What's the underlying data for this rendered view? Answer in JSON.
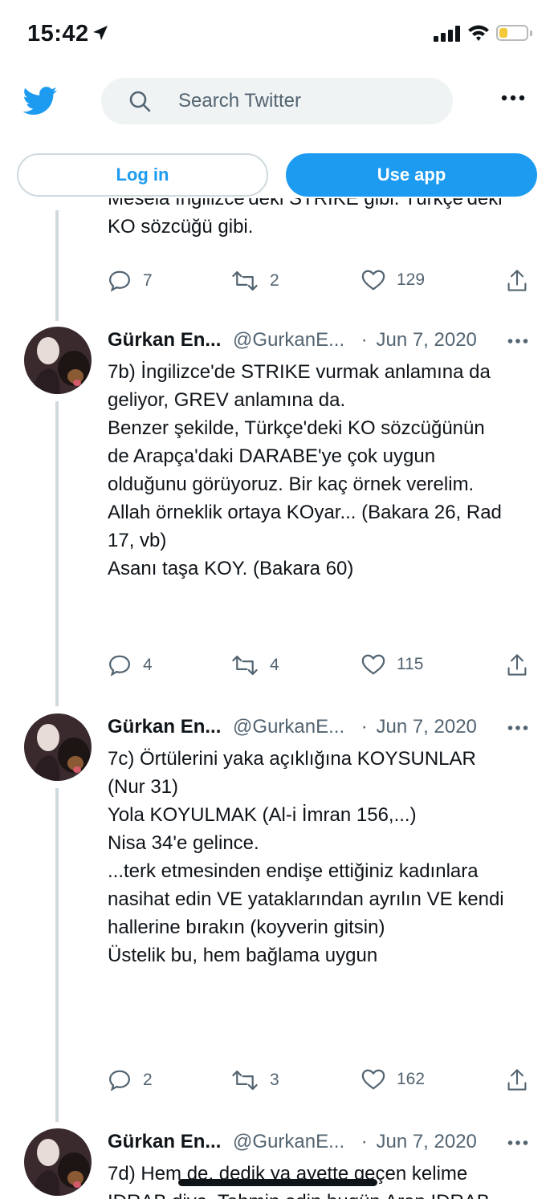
{
  "status": {
    "time": "15:42",
    "battery_color": "#f3c83b"
  },
  "header": {
    "search_placeholder": "Search Twitter"
  },
  "buttons": {
    "login": "Log in",
    "use_app": "Use app"
  },
  "partial_tweet": {
    "text_clipped": "Mesela İngilizce'deki STRIKE gibi. Türkçe'deki",
    "text_last": "KO sözcüğü gibi.",
    "replies": "7",
    "retweets": "2",
    "likes": "129"
  },
  "tweets": [
    {
      "name": "Gürkan En...",
      "handle": "@GurkanE...",
      "dot": "·",
      "date": "Jun 7, 2020",
      "lines": [
        "7b) İngilizce'de STRIKE vurmak anlamına da",
        "geliyor, GREV anlamına da.",
        "",
        "Benzer şekilde, Türkçe'deki KO sözcüğünün",
        "de Arapça'daki DARABE'ye çok uygun",
        "olduğunu görüyoruz. Bir kaç örnek verelim.",
        "",
        "Allah örneklik ortaya KOyar... (Bakara 26, Rad",
        "17, vb)",
        "Asanı taşa KOY. (Bakara 60)"
      ],
      "replies": "4",
      "retweets": "4",
      "likes": "115"
    },
    {
      "name": "Gürkan En...",
      "handle": "@GurkanE...",
      "dot": "·",
      "date": "Jun 7, 2020",
      "lines": [
        "7c) Örtülerini yaka açıklığına KOYSUNLAR",
        "(Nur 31)",
        "Yola KOYULMAK (Al-i İmran 156,...)",
        "",
        "Nisa 34'e gelince.",
        "",
        "...terk etmesinden endişe ettiğiniz kadınlara",
        "nasihat edin VE yataklarından ayrılın VE kendi",
        "hallerine bırakın (koyverin gitsin)",
        "",
        "Üstelik bu, hem bağlama uygun"
      ],
      "replies": "2",
      "retweets": "3",
      "likes": "162"
    },
    {
      "name": "Gürkan En...",
      "handle": "@GurkanE...",
      "dot": "·",
      "date": "Jun 7, 2020",
      "lines": [
        "7d) Hem de, dedik ya ayette geçen kelime",
        "IDRAB diye. Tahmin edin bugün Arap IDRAB"
      ]
    }
  ],
  "colors": {
    "accent": "#1d9bf0",
    "muted": "#536471",
    "thread_line": "#cfd9de"
  }
}
